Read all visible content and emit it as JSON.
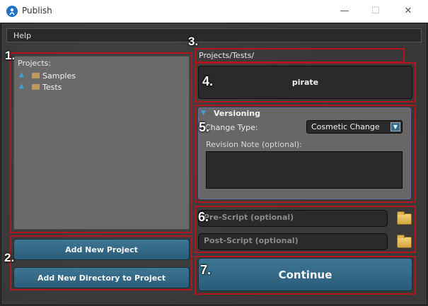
{
  "window": {
    "title": "Publish",
    "minimize_glyph": "—",
    "maximize_glyph": "☐",
    "close_glyph": "✕"
  },
  "menu": {
    "help": "Help"
  },
  "projects": {
    "label": "Projects:",
    "items": [
      {
        "label": "Samples",
        "icon": "folder-icon"
      },
      {
        "label": "Tests",
        "icon": "folder-icon"
      }
    ]
  },
  "buttons": {
    "add_project": "Add New Project",
    "add_directory": "Add New Directory to Project",
    "continue": "Continue"
  },
  "path": "Projects/Tests/",
  "project_name": "pirate",
  "versioning": {
    "title": "Versioning",
    "change_type_label": "Change Type:",
    "change_type_value": "Cosmetic Change",
    "revision_label": "Revision Note (optional):",
    "revision_value": ""
  },
  "scripts": {
    "pre_placeholder": "Pre-Script (optional)",
    "post_placeholder": "Post-Script (optional)"
  },
  "annotations": [
    "1.",
    "2.",
    "3.",
    "4.",
    "5.",
    "6.",
    "7."
  ],
  "colors": {
    "annotation_red": "#b3151d",
    "button_blue": "#3d7693",
    "accent_blue": "#3da2e0",
    "folder_gold": "#d5a53b"
  }
}
